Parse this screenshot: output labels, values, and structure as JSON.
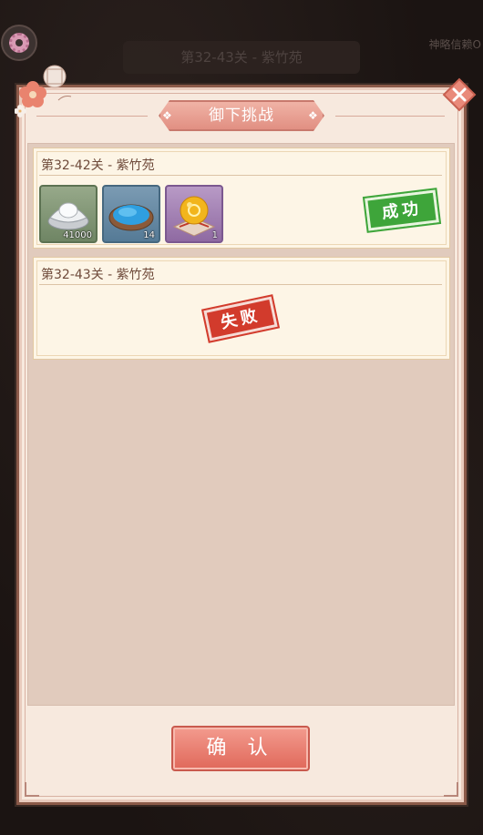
{
  "background": {
    "header_title": "第32-43关 - 紫竹苑",
    "right_text": "神略信赖O"
  },
  "dialog": {
    "title": "御下挑战",
    "confirm_label": "确 认"
  },
  "stages": [
    {
      "title": "第32-42关 - 紫竹苑",
      "result": "成功",
      "rewards": [
        {
          "icon": "silver-ingot-icon",
          "count": "41000",
          "rarity": "green"
        },
        {
          "icon": "blue-pigment-dish-icon",
          "count": "14",
          "rarity": "blue"
        },
        {
          "icon": "golden-ball-icon",
          "count": "1",
          "rarity": "purple"
        }
      ]
    },
    {
      "title": "第32-43关 - 紫竹苑",
      "result": "失败",
      "rewards": []
    }
  ],
  "colors": {
    "success": "#3ea53a",
    "fail": "#d23b2c",
    "accent": "#e0685a"
  }
}
